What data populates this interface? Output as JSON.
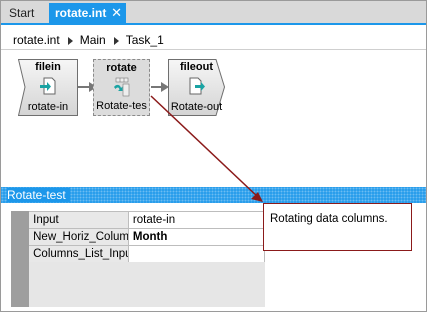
{
  "tabs": [
    {
      "label": "Start"
    },
    {
      "label": "rotate.int",
      "close": "✕"
    }
  ],
  "breadcrumb": [
    "rotate.int",
    "Main",
    "Task_1"
  ],
  "nodes": {
    "filein": {
      "title": "filein",
      "label": "rotate-in"
    },
    "rotate": {
      "title": "rotate",
      "label": "Rotate-tes"
    },
    "fileout": {
      "title": "fileout",
      "label": "Rotate-out"
    }
  },
  "section": {
    "title": "Rotate-test"
  },
  "properties": [
    {
      "key": "Input",
      "value": "rotate-in"
    },
    {
      "key": "New_Horiz_Column",
      "value": "Month"
    },
    {
      "key": "Columns_List_Input",
      "value": ""
    }
  ],
  "description": "Rotating data columns.",
  "colors": {
    "accent": "#1c97ea",
    "callout": "#8b1a1a"
  }
}
